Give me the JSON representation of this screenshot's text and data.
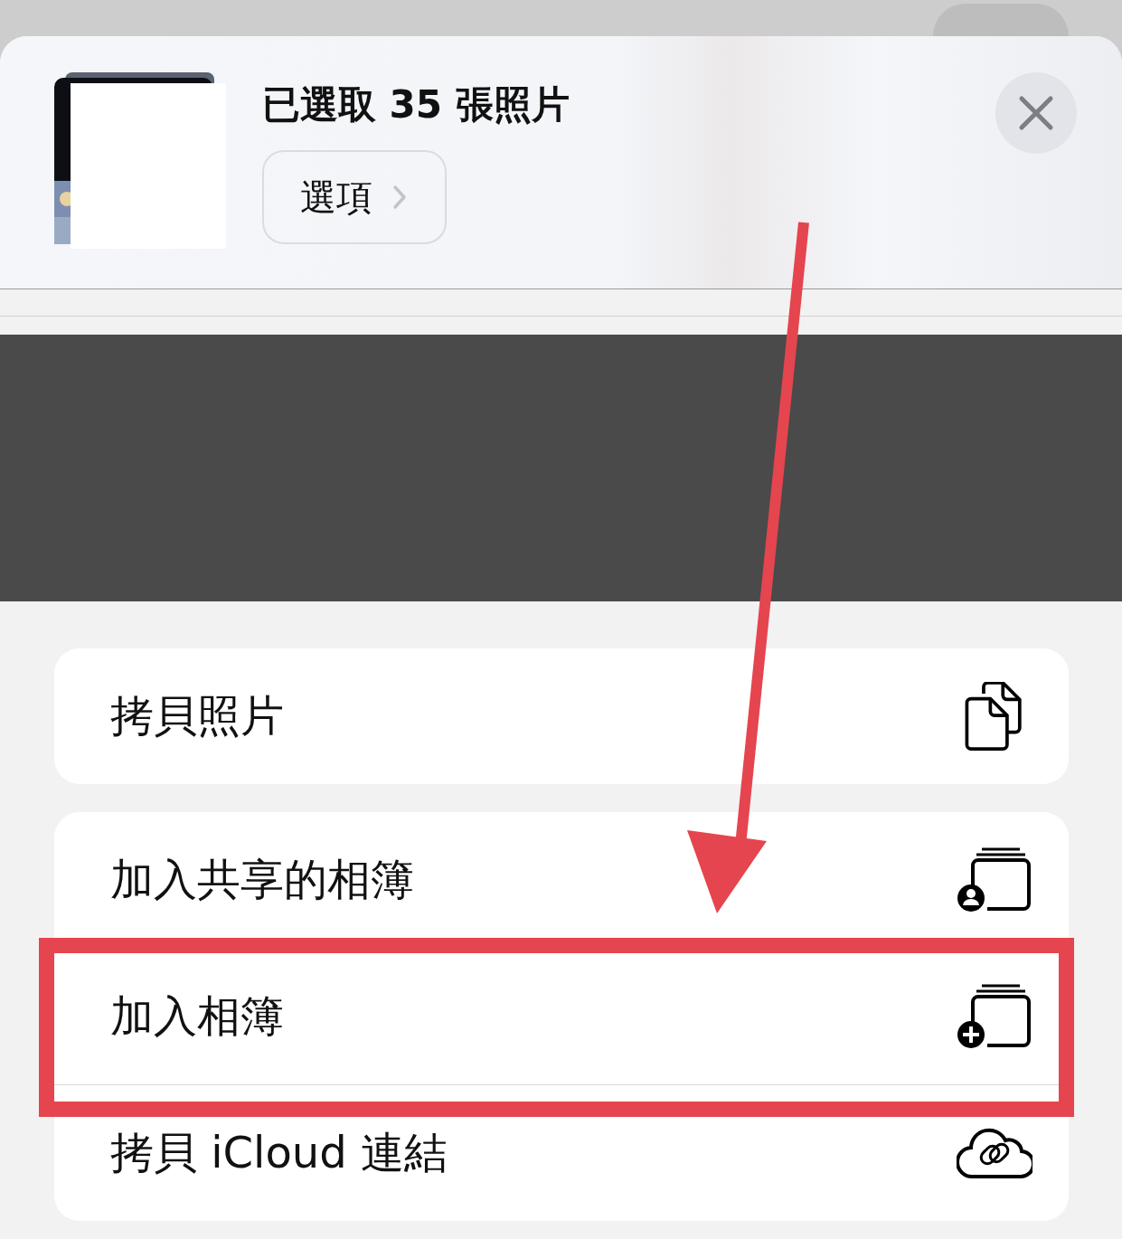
{
  "header": {
    "title": "已選取 35 張照片",
    "options_button": "選項"
  },
  "groups": [
    [
      {
        "label": "拷貝照片",
        "kind": "copy",
        "highlighted": false
      }
    ],
    [
      {
        "label": "加入共享的相簿",
        "kind": "shared-album",
        "highlighted": false
      },
      {
        "label": "加入相簿",
        "kind": "add-album",
        "highlighted": true
      },
      {
        "label": "拷貝 iCloud 連結",
        "kind": "icloud-link",
        "highlighted": false
      }
    ]
  ]
}
